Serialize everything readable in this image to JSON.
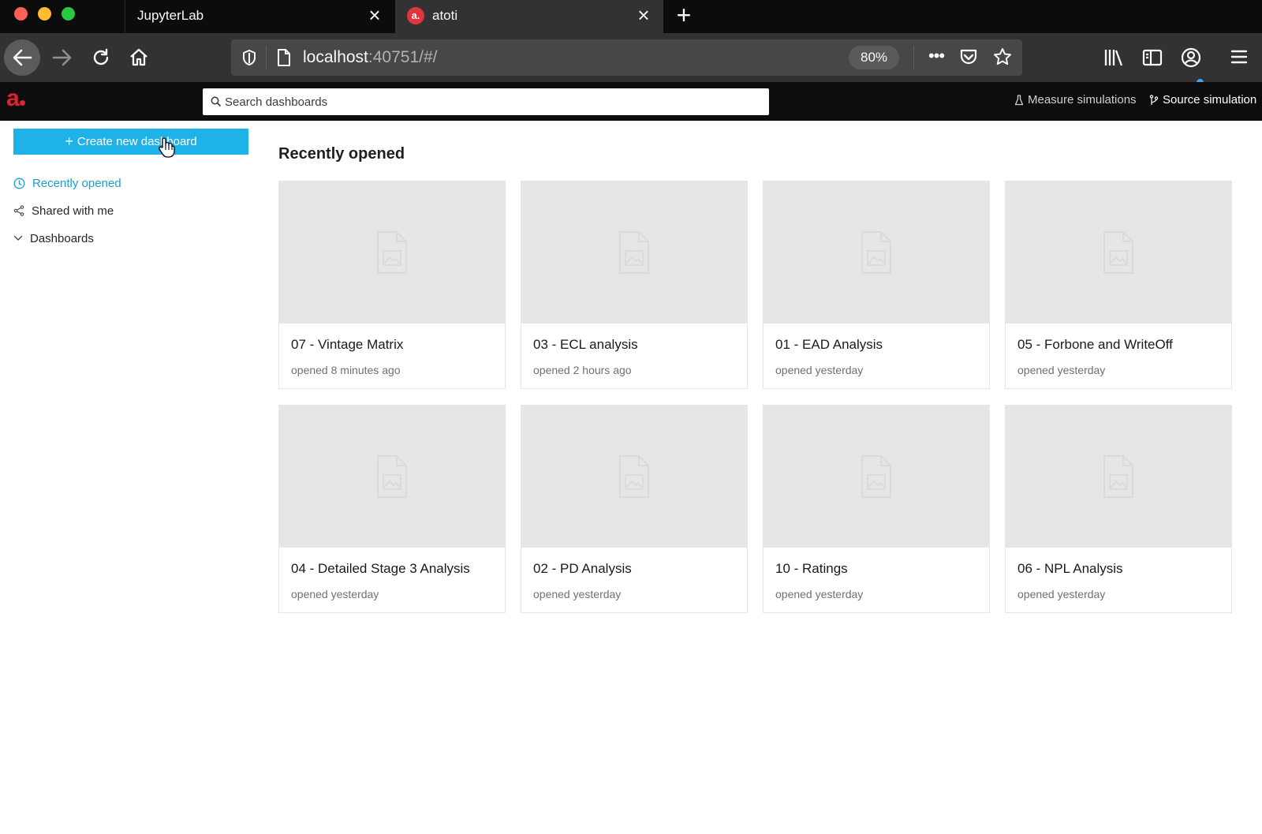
{
  "browser": {
    "tabs": [
      {
        "title": "JupyterLab",
        "active": false
      },
      {
        "title": "atoti",
        "active": true,
        "favicon": "a."
      }
    ],
    "url": {
      "host": "localhost",
      "path": ":40751/#/"
    },
    "zoom": "80%"
  },
  "app": {
    "logo": "a",
    "search_placeholder": "Search dashboards",
    "header_links": {
      "measure_simulations": "Measure simulations",
      "source_simulation": "Source simulation"
    },
    "accent_color": "#1fb2e8",
    "brand_color": "#e0232f"
  },
  "sidebar": {
    "create_button": "Create new dashboard",
    "create_icon": "+",
    "items": [
      {
        "label": "Recently opened",
        "icon": "clock-icon",
        "active": true
      },
      {
        "label": "Shared with me",
        "icon": "share-icon",
        "active": false
      },
      {
        "label": "Dashboards",
        "icon": "chevron-down-icon",
        "active": false
      }
    ]
  },
  "main": {
    "title": "Recently opened",
    "cards": [
      {
        "title": "07 - Vintage Matrix",
        "subtitle": "opened 8 minutes ago"
      },
      {
        "title": "03 - ECL analysis",
        "subtitle": "opened 2 hours ago"
      },
      {
        "title": "01 - EAD Analysis",
        "subtitle": "opened yesterday"
      },
      {
        "title": "05 - Forbone and WriteOff",
        "subtitle": "opened yesterday"
      },
      {
        "title": "04 - Detailed Stage 3 Analysis",
        "subtitle": "opened yesterday"
      },
      {
        "title": "02 - PD Analysis",
        "subtitle": "opened yesterday"
      },
      {
        "title": "10 - Ratings",
        "subtitle": "opened yesterday"
      },
      {
        "title": "06 - NPL Analysis",
        "subtitle": "opened yesterday"
      }
    ]
  }
}
